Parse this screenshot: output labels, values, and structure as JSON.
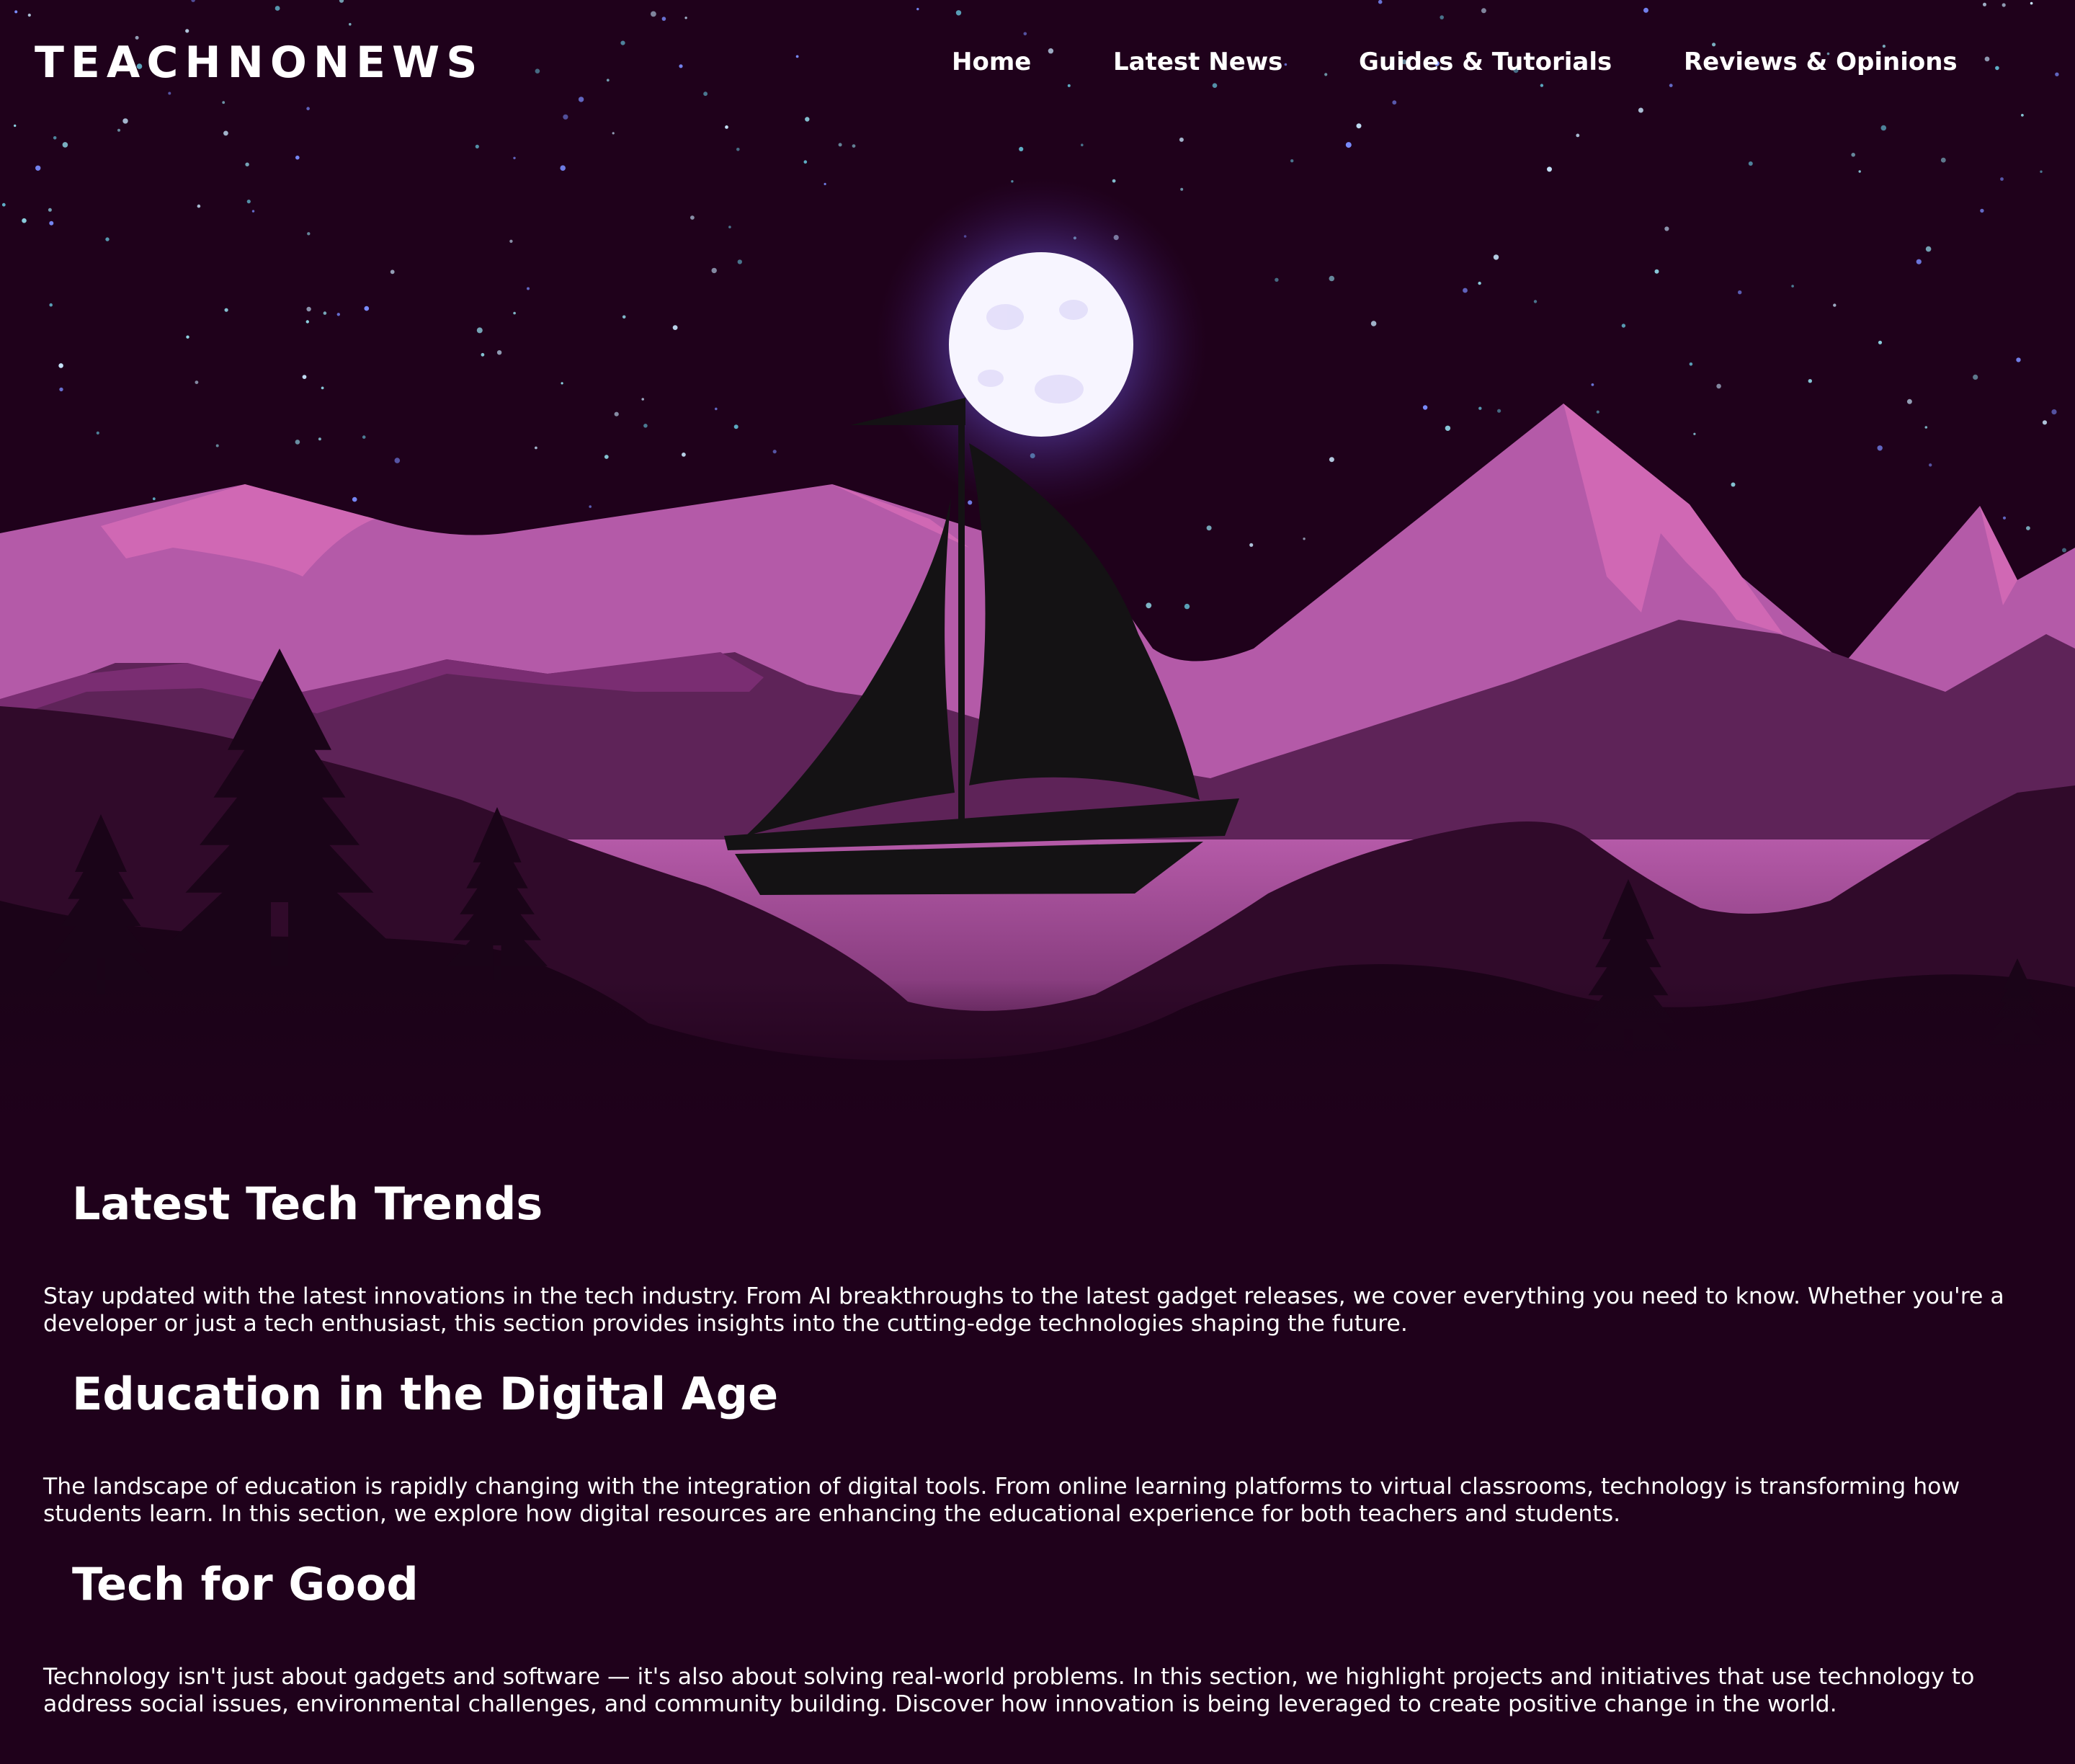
{
  "header": {
    "logo": "TEACHNONEWS",
    "nav": [
      {
        "label": "Home"
      },
      {
        "label": "Latest News"
      },
      {
        "label": "Guides & Tutorials"
      },
      {
        "label": "Reviews & Opinions"
      }
    ]
  },
  "hero": {
    "colors": {
      "sky": "#1f011b",
      "moon": "#f7f5ff",
      "moon_glow": "#7b6cf0",
      "mountain_light": "#b45aa8",
      "mountain_pink": "#d068b4",
      "mountain_mid": "#5e2358",
      "lake": "#a34e98",
      "silhouette": "#170214",
      "boat": "#141214"
    }
  },
  "sections": [
    {
      "title": "Latest Tech Trends",
      "body": "Stay updated with the latest innovations in the tech industry. From AI breakthroughs to the latest gadget releases, we cover everything you need to know. Whether you're a developer or just a tech enthusiast, this section provides insights into the cutting-edge technologies shaping the future."
    },
    {
      "title": "Education in the Digital Age",
      "body": "The landscape of education is rapidly changing with the integration of digital tools. From online learning platforms to virtual classrooms, technology is transforming how students learn. In this section, we explore how digital resources are enhancing the educational experience for both teachers and students."
    },
    {
      "title": "Tech for Good",
      "body": "Technology isn't just about gadgets and software — it's also about solving real-world problems. In this section, we highlight projects and initiatives that use technology to address social issues, environmental challenges, and community building. Discover how innovation is being leveraged to create positive change in the world."
    }
  ]
}
